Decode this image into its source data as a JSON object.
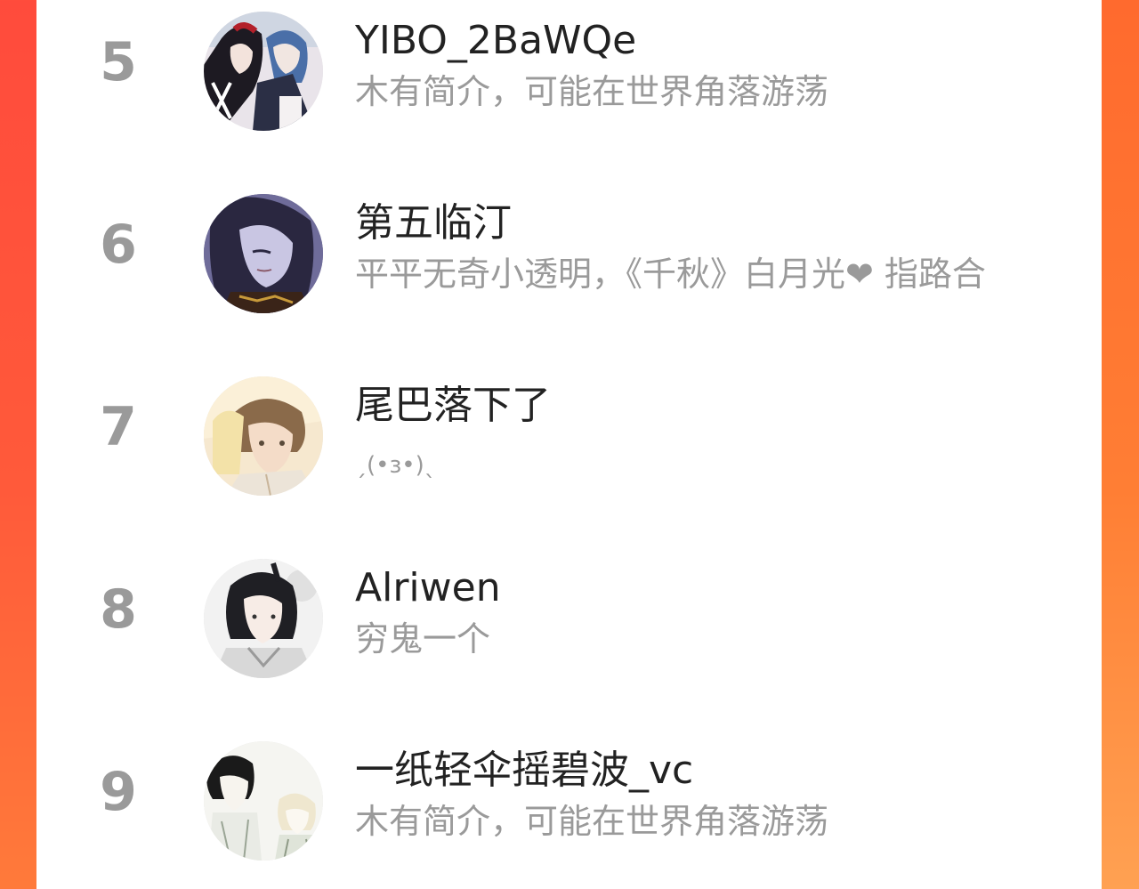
{
  "list": {
    "items": [
      {
        "rank": "5",
        "name": "YIBO_2BaWQe",
        "bio": "木有简介，可能在世界角落游荡",
        "avatar_icon": "avatar-anime-couple-icon"
      },
      {
        "rank": "6",
        "name": "第五临汀",
        "bio": "平平无奇小透明，《千秋》白月光❤  指路合",
        "avatar_icon": "avatar-longhair-portrait-icon"
      },
      {
        "rank": "7",
        "name": "尾巴落下了",
        "bio": "ˏ(•ɜ•)ˎ",
        "avatar_icon": "avatar-boy-blond-icon"
      },
      {
        "rank": "8",
        "name": "Alriwen",
        "bio": "穷鬼一个",
        "avatar_icon": "avatar-guqing-man-icon"
      },
      {
        "rank": "9",
        "name": "一纸轻伞摇碧波_vc",
        "bio": "木有简介，可能在世界角落游荡",
        "avatar_icon": "avatar-sketch-pair-icon"
      }
    ]
  },
  "colors": {
    "background_left": "#ff4b3c",
    "background_right": "#ff7e34",
    "rank_text": "#9a9a9a",
    "name_text": "#222222",
    "bio_text": "#9a9a9a"
  }
}
